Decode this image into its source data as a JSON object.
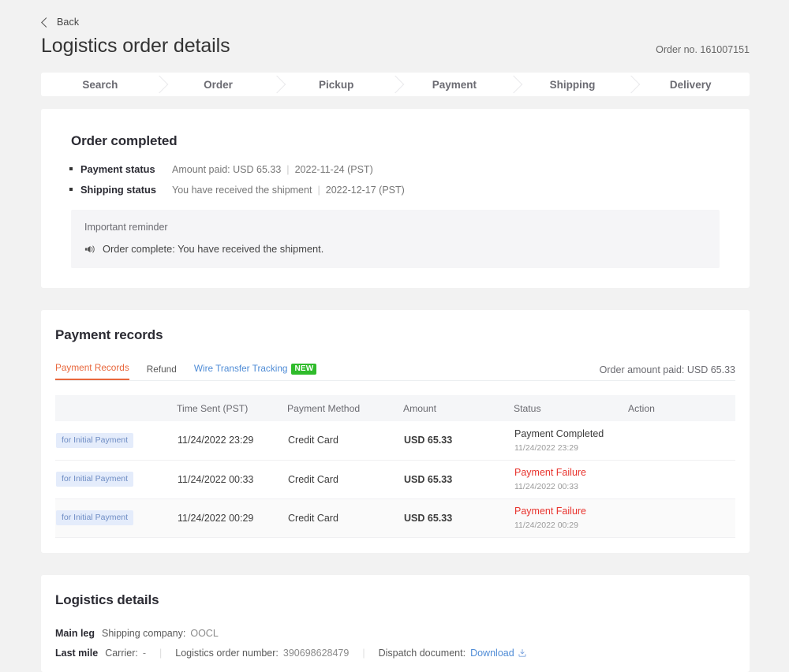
{
  "header": {
    "back_label": "Back",
    "title": "Logistics order details",
    "order_no": "Order no. 161007151"
  },
  "stepper": {
    "steps": [
      {
        "label": "Search"
      },
      {
        "label": "Order"
      },
      {
        "label": "Pickup"
      },
      {
        "label": "Payment"
      },
      {
        "label": "Shipping"
      },
      {
        "label": "Delivery"
      }
    ]
  },
  "order_completed": {
    "title": "Order completed",
    "rows": [
      {
        "key": "Payment status",
        "value": "Amount paid: USD 65.33",
        "date": "2022-11-24 (PST)"
      },
      {
        "key": "Shipping status",
        "value": "You have received the shipment",
        "date": "2022-12-17 (PST)"
      }
    ],
    "reminder": {
      "title": "Important reminder",
      "message": "Order complete: You have received the shipment."
    }
  },
  "payment_records": {
    "title": "Payment records",
    "tabs": [
      {
        "label": "Payment Records",
        "active": true,
        "badge": ""
      },
      {
        "label": "Refund",
        "active": false,
        "badge": ""
      },
      {
        "label": "Wire Transfer Tracking",
        "active": false,
        "badge": "NEW"
      }
    ],
    "amount_paid": "Order amount paid: USD 65.33",
    "columns": [
      "",
      "Time Sent (PST)",
      "Payment Method",
      "Amount",
      "Status",
      "Action"
    ],
    "rows": [
      {
        "tag": "for Initial Payment",
        "time_sent": "11/24/2022 23:29",
        "method": "Credit Card",
        "amount": "USD 65.33",
        "status": "Payment Completed",
        "status_time": "11/24/2022 23:29",
        "status_failed": false,
        "action": ""
      },
      {
        "tag": "for Initial Payment",
        "time_sent": "11/24/2022 00:33",
        "method": "Credit Card",
        "amount": "USD 65.33",
        "status": "Payment Failure",
        "status_time": "11/24/2022 00:33",
        "status_failed": true,
        "action": ""
      },
      {
        "tag": "for Initial Payment",
        "time_sent": "11/24/2022 00:29",
        "method": "Credit Card",
        "amount": "USD 65.33",
        "status": "Payment Failure",
        "status_time": "11/24/2022 00:29",
        "status_failed": true,
        "action": ""
      }
    ]
  },
  "logistics_details": {
    "title": "Logistics details",
    "main_leg": {
      "leg_label": "Main leg",
      "shipping_company_label": "Shipping company:",
      "shipping_company_value": "OOCL"
    },
    "last_mile": {
      "leg_label": "Last mile",
      "carrier_label": "Carrier:",
      "carrier_value": "-",
      "order_number_label": "Logistics order number:",
      "order_number_value": "390698628479",
      "dispatch_label": "Dispatch document:",
      "download_label": "Download"
    }
  },
  "colors": {
    "accent": "#e8673c",
    "link": "#4f8cd6",
    "badge_new": "#2fbb2b",
    "error": "#e8342e",
    "tag_bg": "#e4ecfb",
    "page_bg": "#f2f2f2"
  }
}
